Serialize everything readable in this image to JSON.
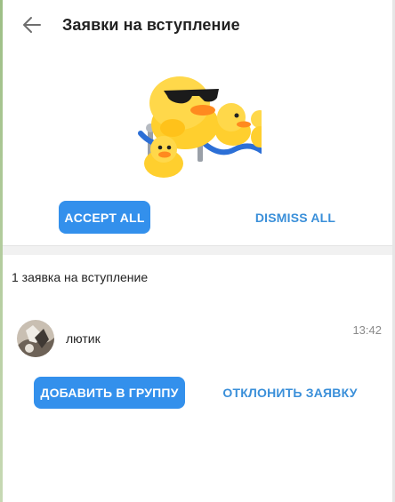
{
  "header": {
    "title": "Заявки на вступление",
    "back_icon": "arrow-left-icon"
  },
  "sticker": {
    "icon": "duck-sticker-icon",
    "colors": {
      "duck": "#ffcf2e",
      "beak": "#ff8a1f",
      "rope": "#2c6fd6",
      "post": "#9aa0a8"
    }
  },
  "bulk_actions": {
    "accept_all": "ACCEPT ALL",
    "dismiss_all": "DISMISS ALL"
  },
  "requests": {
    "count_label": "1 заявка на вступление",
    "items": [
      {
        "name": "лютик",
        "time": "13:42",
        "accept_label": "ДОБАВИТЬ В ГРУППУ",
        "decline_label": "ОТКЛОНИТЬ ЗАЯВКУ"
      }
    ]
  },
  "colors": {
    "accent": "#3390ec",
    "link": "#3a8fd9",
    "text": "#222222",
    "muted": "#8a8a8a",
    "divider": "#f1f1f1"
  }
}
